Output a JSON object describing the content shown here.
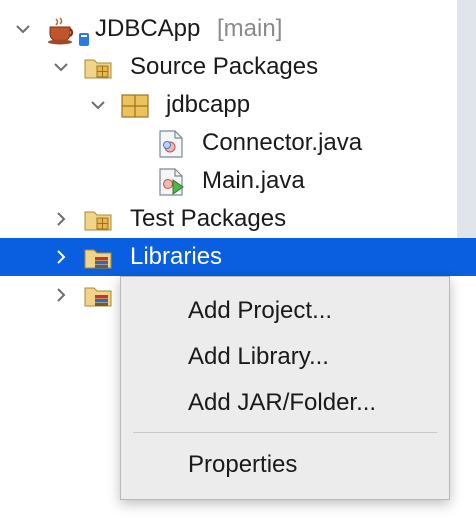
{
  "project": {
    "name": "JDBCApp",
    "branch": "[main]"
  },
  "tree": {
    "source_packages": "Source Packages",
    "package": "jdbcapp",
    "files": [
      "Connector.java",
      "Main.java"
    ],
    "test_packages": "Test Packages",
    "libraries": "Libraries"
  },
  "context_menu": {
    "items": [
      "Add Project...",
      "Add Library...",
      "Add JAR/Folder...",
      "Properties"
    ]
  },
  "colors": {
    "selection": "#0a5fe0",
    "menu_bg": "#ececec"
  },
  "icons": [
    "coffee-project-icon",
    "folder-packages-icon",
    "package-icon",
    "java-file-icon",
    "java-main-file-icon",
    "folder-libraries-icon"
  ]
}
